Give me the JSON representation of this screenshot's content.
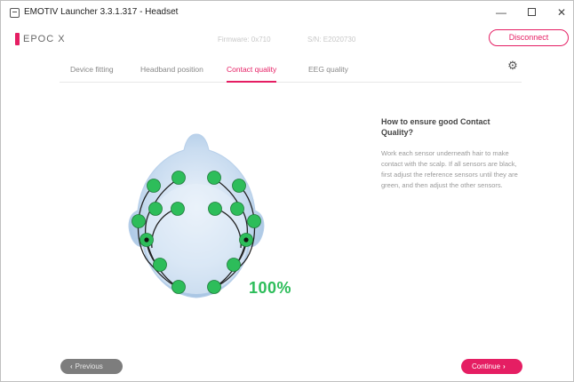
{
  "window": {
    "title": "EMOTIV Launcher 3.3.1.317 - Headset",
    "minimize_glyph": "—",
    "close_glyph": "✕"
  },
  "header": {
    "brand": "EPOC X",
    "firmware": "Firmware: 0x710",
    "serial": "S/N: E2020730",
    "disconnect_label": "Disconnect",
    "accent_color": "#e51e63"
  },
  "tabs": [
    {
      "label": "Device fitting",
      "active": false
    },
    {
      "label": "Headband position",
      "active": false
    },
    {
      "label": "Contact quality",
      "active": true
    },
    {
      "label": "EEG quality",
      "active": false
    }
  ],
  "settings_icon": "gear-icon",
  "contact_quality": {
    "percent": "100%",
    "sensor_color_good": "#2dbd5a",
    "reference_sensor_color": "#111111"
  },
  "help": {
    "title": "How to ensure good Contact Quality?",
    "body": "Work each sensor underneath hair to make contact with the scalp. If all sensors are black, first adjust the reference sensors until they are green, and then adjust the other sensors."
  },
  "footer": {
    "previous_label": "Previous",
    "continue_label": "Continue"
  }
}
